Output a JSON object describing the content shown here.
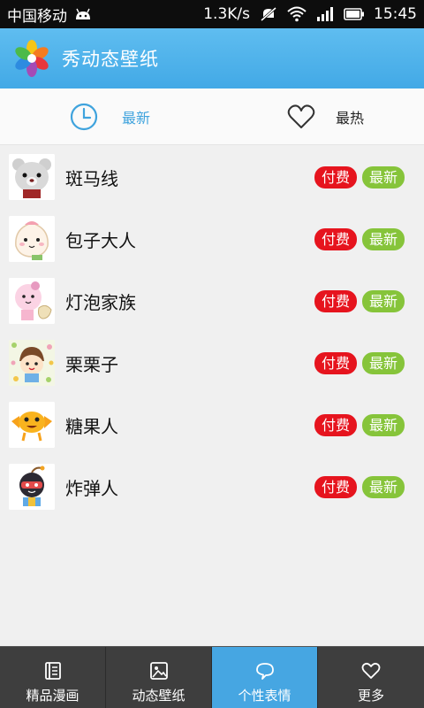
{
  "statusbar": {
    "carrier": "中国移动",
    "speed": "1.3K/s",
    "time": "15:45"
  },
  "app": {
    "title": "秀动态壁纸"
  },
  "tabs": [
    {
      "label": "最新",
      "icon": "clock-icon",
      "selected": true
    },
    {
      "label": "最热",
      "icon": "heart-outline-icon",
      "selected": false
    }
  ],
  "items": [
    {
      "name": "斑马线",
      "icon": "bear-sticker",
      "badges": [
        "付费",
        "最新"
      ]
    },
    {
      "name": "包子大人",
      "icon": "bun-sticker",
      "badges": [
        "付费",
        "最新"
      ]
    },
    {
      "name": "灯泡家族",
      "icon": "bulb-sticker",
      "badges": [
        "付费",
        "最新"
      ]
    },
    {
      "name": "栗栗子",
      "icon": "chestnut-sticker",
      "badges": [
        "付费",
        "最新"
      ]
    },
    {
      "name": "糖果人",
      "icon": "candy-sticker",
      "badges": [
        "付费",
        "最新"
      ]
    },
    {
      "name": "炸弹人",
      "icon": "bomb-sticker",
      "badges": [
        "付费",
        "最新"
      ]
    }
  ],
  "bottom_nav": [
    {
      "label": "精品漫画",
      "icon": "book-icon",
      "active": false
    },
    {
      "label": "动态壁纸",
      "icon": "picture-icon",
      "active": false
    },
    {
      "label": "个性表情",
      "icon": "chat-bubble-icon",
      "active": true
    },
    {
      "label": "更多",
      "icon": "heart-icon",
      "active": false
    }
  ],
  "colors": {
    "titlebar": "#4aaee8",
    "accent": "#3fa3dd",
    "paid_badge": "#e6141e",
    "new_badge": "#86c43a",
    "bottom_nav": "#3e3e3e"
  }
}
